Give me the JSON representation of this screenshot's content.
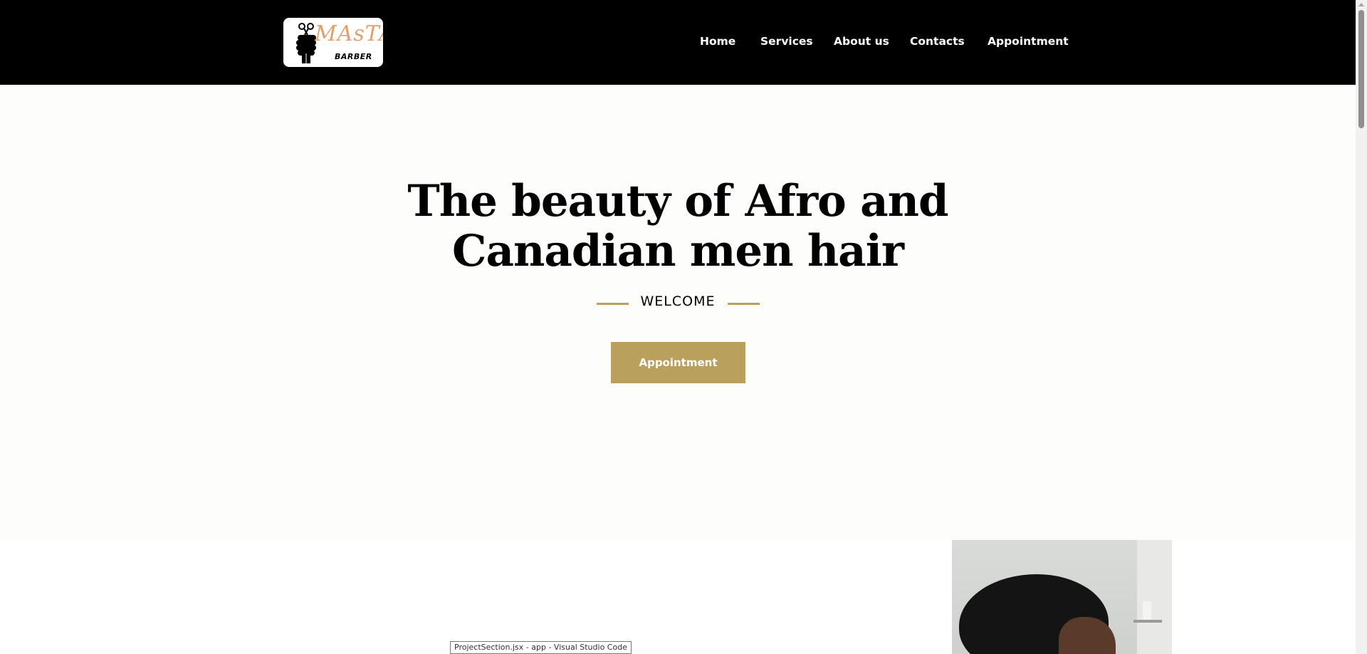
{
  "logo": {
    "script_text": "MAsTA",
    "word": "BARBER",
    "icon": "fist-scissors-icon"
  },
  "nav": {
    "items": [
      {
        "label": "Home"
      },
      {
        "label": "Services"
      },
      {
        "label": "About us"
      },
      {
        "label": "Contacts"
      },
      {
        "label": "Appointment"
      }
    ]
  },
  "hero": {
    "title_line1": "The beauty of Afro and",
    "title_line2": "Canadian men hair",
    "welcome": "WELCOME",
    "cta_label": "Appointment"
  },
  "tooltip": {
    "text": "ProjectSection.jsx - app - Visual Studio Code"
  },
  "colors": {
    "header_bg": "#000000",
    "accent_gold": "#b9a05c",
    "hero_bg": "#fdfdfb",
    "logo_script": "#e3a06b"
  }
}
